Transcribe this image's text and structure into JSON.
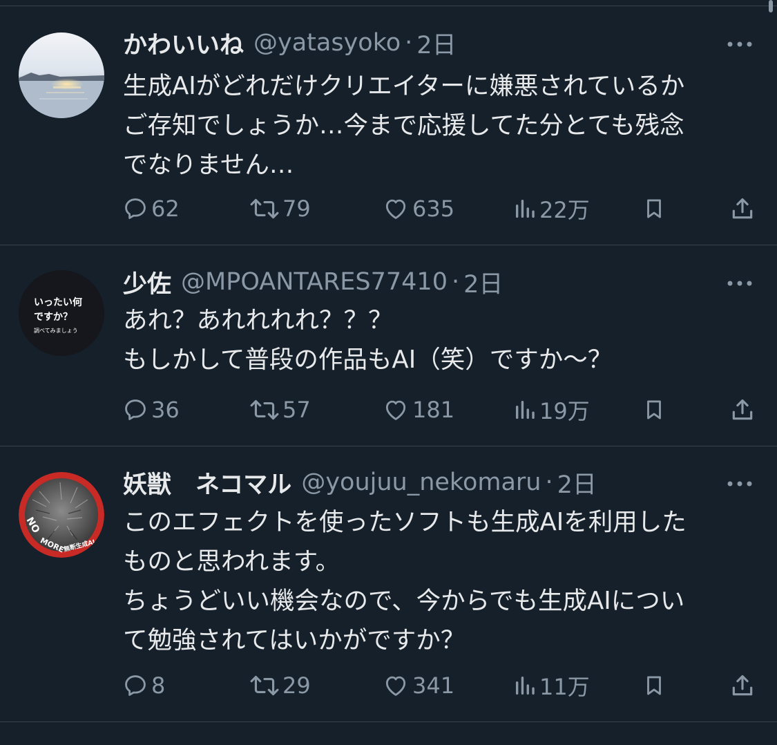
{
  "tweets": [
    {
      "display_name": "かわいいね",
      "handle": "@yatasyoko",
      "separator": "·",
      "time": "2日",
      "lines": [
        "生成AIがどれだけクリエイターに嫌悪されているか",
        "ご存知でしょうか…今まで応援してた分とても残念",
        "でなりません…"
      ],
      "replies": "62",
      "retweets": "79",
      "likes": "635",
      "views": "22万"
    },
    {
      "display_name": "少佐",
      "handle": "@MPOANTARES77410",
      "separator": "·",
      "time": "2日",
      "avatar_text": [
        "いったい何",
        "ですか？",
        "調べてみましょう"
      ],
      "lines": [
        "あれ？あれれれれ？？？",
        "もしかして普段の作品もAI（笑）ですか〜？"
      ],
      "replies": "36",
      "retweets": "57",
      "likes": "181",
      "views": "19万"
    },
    {
      "display_name": "妖獣　ネコマル",
      "handle": "@youjuu_nekomaru",
      "separator": "·",
      "time": "2日",
      "avatar_text": [
        "NO",
        "MORE",
        "無断生成AI"
      ],
      "lines": [
        "このエフェクトを使ったソフトも生成AIを利用した",
        "ものと思われます。",
        "ちょうどいい機会なので、今からでも生成AIについ",
        "て勉強されてはいかがですか？"
      ],
      "replies": "8",
      "retweets": "29",
      "likes": "341",
      "views": "11万"
    }
  ],
  "icons": {
    "reply": "reply-icon",
    "retweet": "retweet-icon",
    "like": "like-icon",
    "views": "views-icon",
    "bookmark": "bookmark-icon",
    "share": "share-icon",
    "more": "more-icon"
  },
  "colors": {
    "background": "#15202b",
    "text": "#e7e9ea",
    "secondary": "#8b98a5",
    "divider": "#38444d"
  }
}
